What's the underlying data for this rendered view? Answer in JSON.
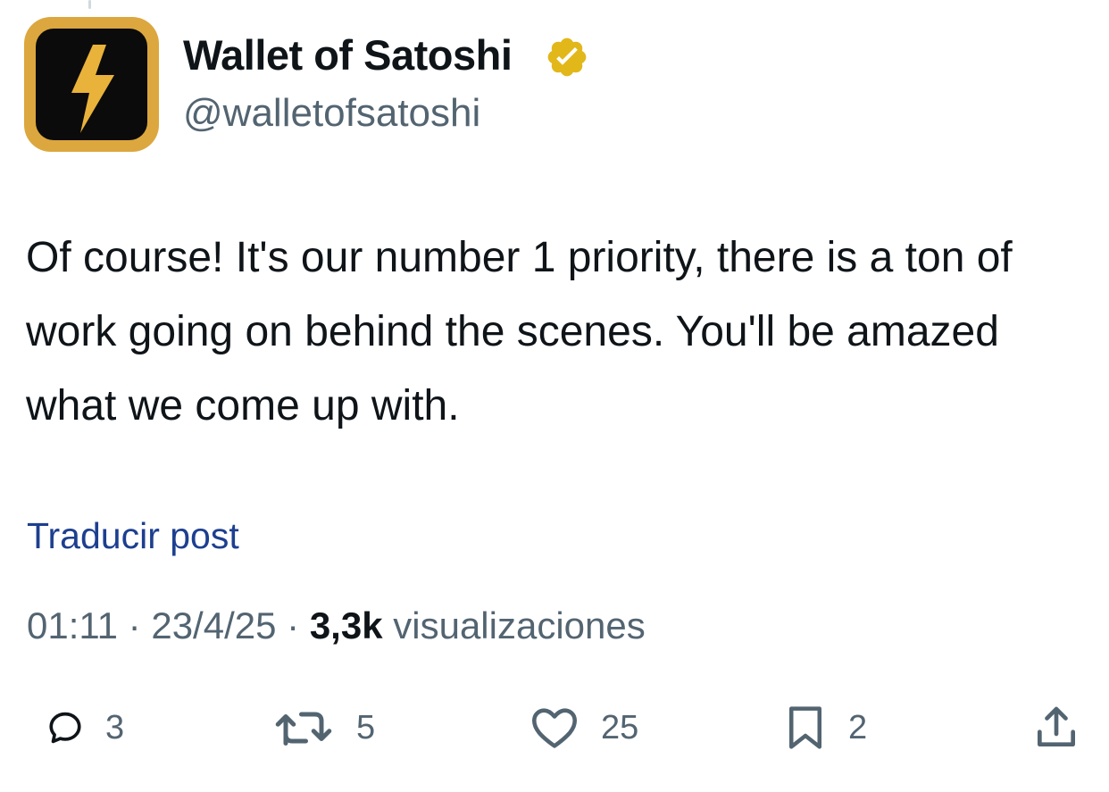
{
  "post": {
    "author": {
      "display_name": "Wallet of Satoshi",
      "handle": "@walletofsatoshi",
      "verified": true,
      "verified_badge_color": "#e2b719",
      "avatar_background": "#dca73e",
      "avatar_icon": "lightning-bolt-icon"
    },
    "text": "Of course! It's our number 1 priority, there is a ton of work going on behind the scenes. You'll be amazed what we come up with.",
    "translate_label": "Traducir post",
    "time": "01:11",
    "date": "23/4/25",
    "views_count": "3,3k",
    "views_label": "visualizaciones",
    "separator": "·"
  },
  "actions": {
    "reply": {
      "icon": "reply-icon",
      "count": "3"
    },
    "retweet": {
      "icon": "retweet-icon",
      "count": "5"
    },
    "like": {
      "icon": "heart-icon",
      "count": "25"
    },
    "bookmark": {
      "icon": "bookmark-icon",
      "count": "2"
    },
    "share": {
      "icon": "share-icon"
    }
  },
  "colors": {
    "text_primary": "#0f1419",
    "text_secondary": "#536471",
    "link": "#1d3f8f"
  }
}
